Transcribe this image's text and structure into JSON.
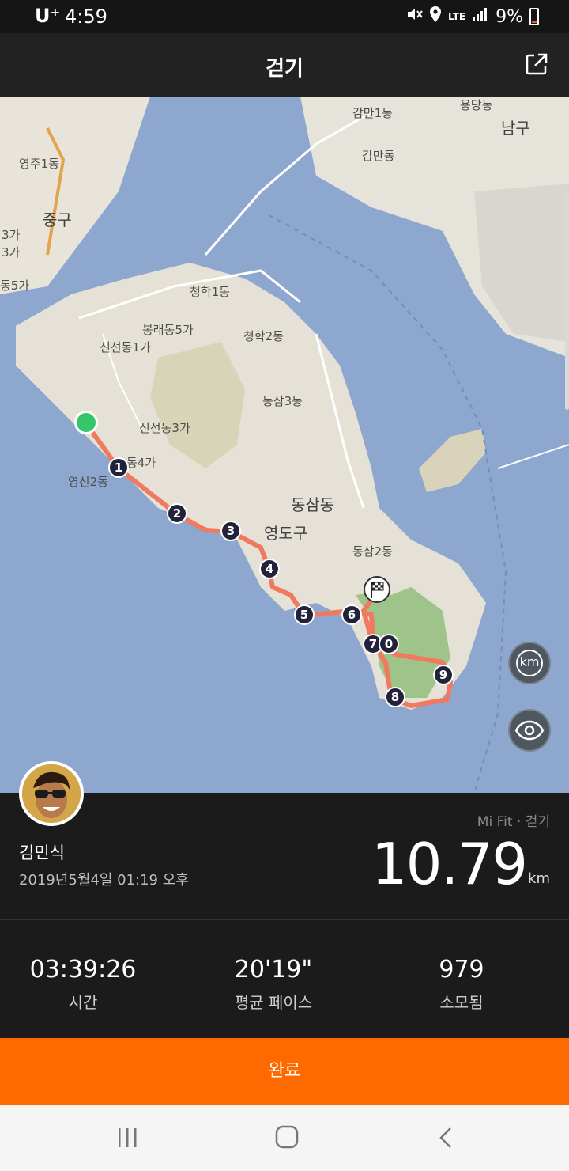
{
  "status": {
    "carrier": "U⁺",
    "time": "4:59",
    "network": "LTE",
    "battery": "9%"
  },
  "header": {
    "title": "걷기",
    "share_icon": "share-icon"
  },
  "map": {
    "labels": [
      "영주1동",
      "중구",
      "3가",
      "3가",
      "동5가",
      "감만1동",
      "감만동",
      "용당동",
      "남구",
      "청학1동",
      "봉래동5가",
      "신선동1가",
      "청학2동",
      "동삼3동",
      "신선동3가",
      "동4가",
      "영선2동",
      "동삼동",
      "영도구",
      "동삼2동"
    ],
    "markers": [
      "1",
      "2",
      "3",
      "4",
      "5",
      "6",
      "7",
      "0",
      "8",
      "9"
    ],
    "start_color": "#34c76a",
    "route_color": "#f07a5f",
    "km_button": "km",
    "eye_icon": "eye-icon"
  },
  "activity": {
    "source": "Mi Fit · 걷기",
    "user_name": "김민식",
    "date": "2019년5월4일 01:19 오후",
    "distance": "10.79",
    "distance_unit": "km"
  },
  "stats": [
    {
      "value": "03:39:26",
      "label": "시간"
    },
    {
      "value": "20'19\"",
      "label": "평균 페이스"
    },
    {
      "value": "979",
      "label": "소모됨"
    }
  ],
  "actions": {
    "done_label": "완료"
  },
  "colors": {
    "accent": "#ff6a00",
    "background": "#1b1b1b"
  }
}
